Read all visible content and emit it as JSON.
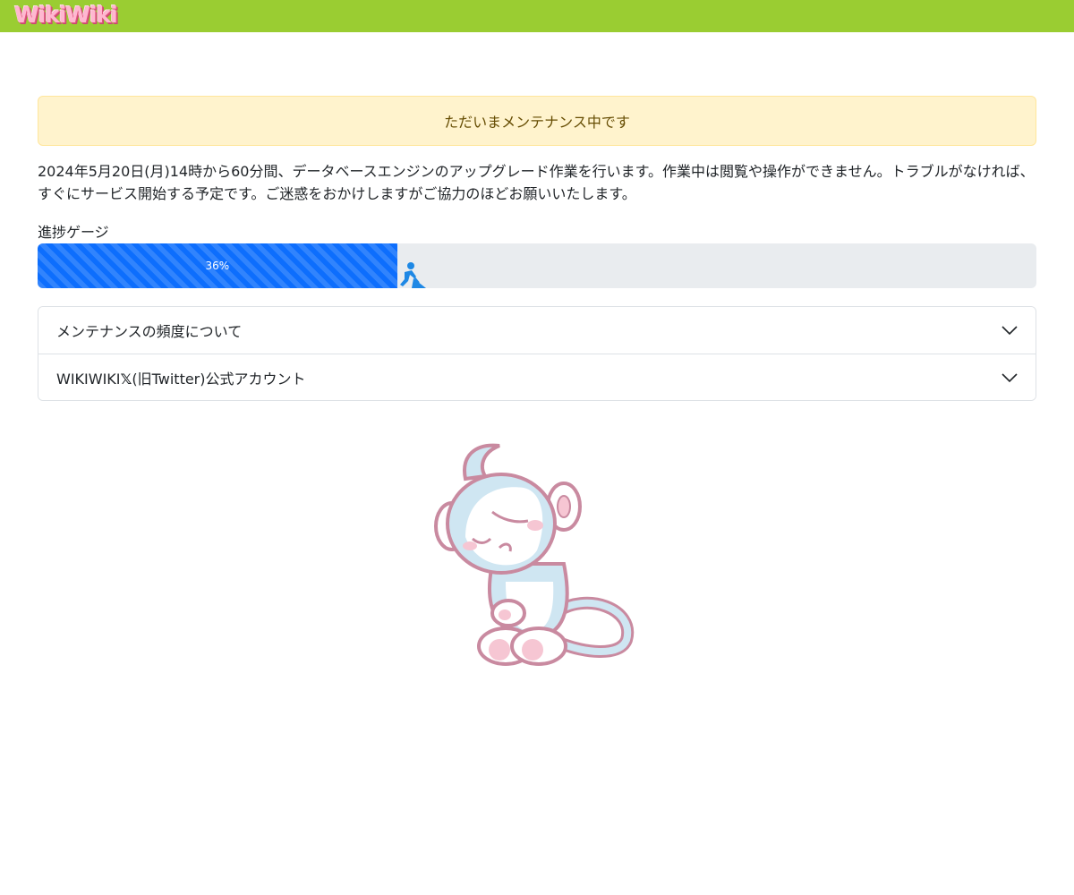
{
  "header": {
    "logo_text": "WikiWiki"
  },
  "alert": {
    "message": "ただいまメンテナンス中です"
  },
  "description": "2024年5月20日(月)14時から60分間、データベースエンジンのアップグレード作業を行います。作業中は閲覧や操作ができません。トラブルがなければ、すぐにサービス開始する予定です。ご迷惑をおかけしますがご協力のほどお願いいたします。",
  "progress": {
    "label": "進捗ゲージ",
    "value": 36,
    "value_text": "36%",
    "icon": "construction-worker-icon"
  },
  "accordion": [
    {
      "label": "メンテナンスの頻度について",
      "icon": "chevron-down-icon"
    },
    {
      "label_before": "WIKIWIKI",
      "x_logo": "𝕏",
      "label_after": "(旧Twitter)公式アカウント",
      "icon": "chevron-down-icon"
    }
  ],
  "colors": {
    "header": "#9acd32",
    "alert_bg": "#fff3cd",
    "progress_bar": "#0d6efd",
    "progress_track": "#e9ecef"
  },
  "mascot": {
    "icon": "sleeping-monkey-mascot"
  }
}
